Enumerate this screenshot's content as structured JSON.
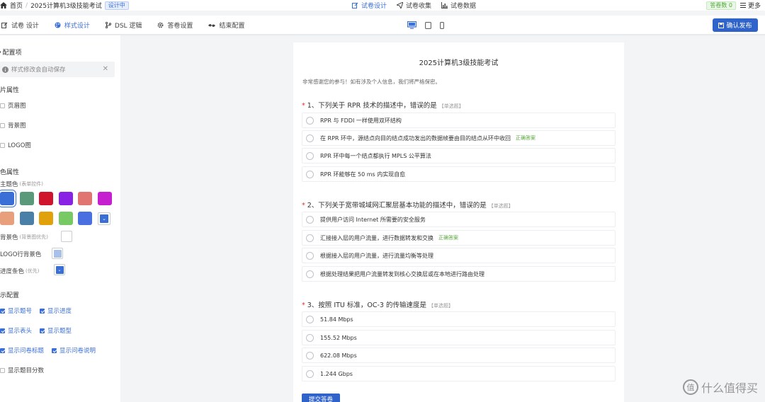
{
  "breadcrumb": {
    "home": "首页",
    "title": "2025计算机3级技能考试",
    "status": "设计中"
  },
  "topnav": [
    {
      "label": "试卷设计",
      "active": true
    },
    {
      "label": "试卷收集",
      "active": false
    },
    {
      "label": "试卷数据",
      "active": false
    }
  ],
  "topright": {
    "answers": "答卷数 0",
    "more": "更多"
  },
  "tabs": [
    {
      "label": "试卷 设计",
      "icon": "edit-icon",
      "active": false
    },
    {
      "label": "样式设计",
      "icon": "palette-icon",
      "active": true
    },
    {
      "label": "DSL 逻辑",
      "icon": "branch-icon",
      "active": false
    },
    {
      "label": "答卷设置",
      "icon": "gear-icon",
      "active": false
    },
    {
      "label": "结束配置",
      "icon": "flag-icon",
      "active": false
    }
  ],
  "publish_label": "确认发布",
  "panel": {
    "title": "配置项",
    "autosave": "样式修改会自动保存",
    "image_section": "片属性",
    "image_items": [
      "页眉图",
      "背景图",
      "LOGO图"
    ],
    "color_section": "色属性",
    "theme_label": "主题色",
    "theme_hint": "(表单控件)",
    "theme_colors": [
      "#3b6fd8",
      "#5a9a7b",
      "#d0142c",
      "#8a22e6",
      "#e07572",
      "#c61fd0",
      "#e8a07c",
      "#4a7fa8",
      "#e0a10b",
      "#77c963",
      "#4a6fe0"
    ],
    "bg_label": "背景色",
    "bg_hint": "(背景图优先)",
    "logo_bg_label": "LOGO行背景色",
    "progress_label": "进度条色",
    "progress_hint": "(优先)",
    "display_section": "示配置",
    "display_items": [
      {
        "label": "显示题号",
        "on": true
      },
      {
        "label": "显示进度",
        "on": true
      },
      {
        "label": "显示表头",
        "on": true
      },
      {
        "label": "显示题型",
        "on": true
      },
      {
        "label": "显示问卷标题",
        "on": true
      },
      {
        "label": "显示问卷说明",
        "on": true
      },
      {
        "label": "显示题目分数",
        "on": false
      }
    ]
  },
  "form": {
    "title": "2025计算机3级技能考试",
    "description": "非常感谢您的参与！如有涉及个人信息，我们将严格保密。",
    "submit": "提交答卷",
    "questions": [
      {
        "title": "1、下列关于 RPR 技术的描述中，错误的是",
        "type": "【单选题】",
        "options": [
          {
            "text": "RPR 与 FDDI 一样使用双环结构",
            "tag": ""
          },
          {
            "text": "在 RPR 环中，源结点向目的结点成功发出的数据帧要由目的结点从环中收回",
            "tag": "正确答案"
          },
          {
            "text": "RPR 环中每一个结点都执行 MPLS 公平算法",
            "tag": ""
          },
          {
            "text": "RPR 环能够在 50 ms 内实现自愈",
            "tag": ""
          }
        ]
      },
      {
        "title": "2、下列关于宽带城域网汇聚层基本功能的描述中，错误的是",
        "type": "【单选题】",
        "options": [
          {
            "text": "提供用户访问 Internet 所需要的安全服务",
            "tag": ""
          },
          {
            "text": "汇接接入层的用户流量，进行数据转发和交换",
            "tag": "正确答案"
          },
          {
            "text": "根据接入层的用户流量，进行流量均衡等处理",
            "tag": ""
          },
          {
            "text": "根据处理结果把用户流量转发到核心交换层或在本地进行路由处理",
            "tag": ""
          }
        ]
      },
      {
        "title": "3、按照 ITU 标准，OC-3 的传输速度是",
        "type": "【单选题】",
        "options": [
          {
            "text": "51.84 Mbps",
            "tag": ""
          },
          {
            "text": "155.52 Mbps",
            "tag": ""
          },
          {
            "text": "622.08 Mbps",
            "tag": ""
          },
          {
            "text": "1.244 Gbps",
            "tag": ""
          }
        ]
      }
    ]
  },
  "watermark": "什么值得买",
  "watermark_glyph": "值"
}
